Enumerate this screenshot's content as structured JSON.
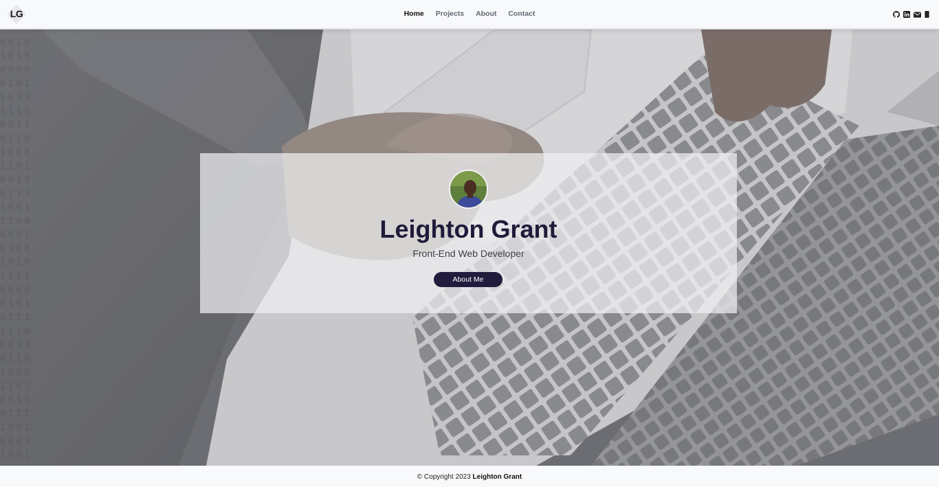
{
  "brand": {
    "logo_text": "LG"
  },
  "nav": {
    "items": [
      "Home",
      "Projects",
      "About",
      "Contact"
    ],
    "active": "Home"
  },
  "social": {
    "icons": [
      "github-icon",
      "linkedin-icon",
      "mail-icon",
      "phone-icon"
    ]
  },
  "hero": {
    "name": "Leighton Grant",
    "tagline": "Front-End Web Developer",
    "button_label": "About Me"
  },
  "footer": {
    "copyright": "© Copyright 2023",
    "owner": "Leighton Grant"
  },
  "colors": {
    "accent": "#211c3d",
    "heading": "#201b3a",
    "navbar": "#f8f9fb"
  }
}
